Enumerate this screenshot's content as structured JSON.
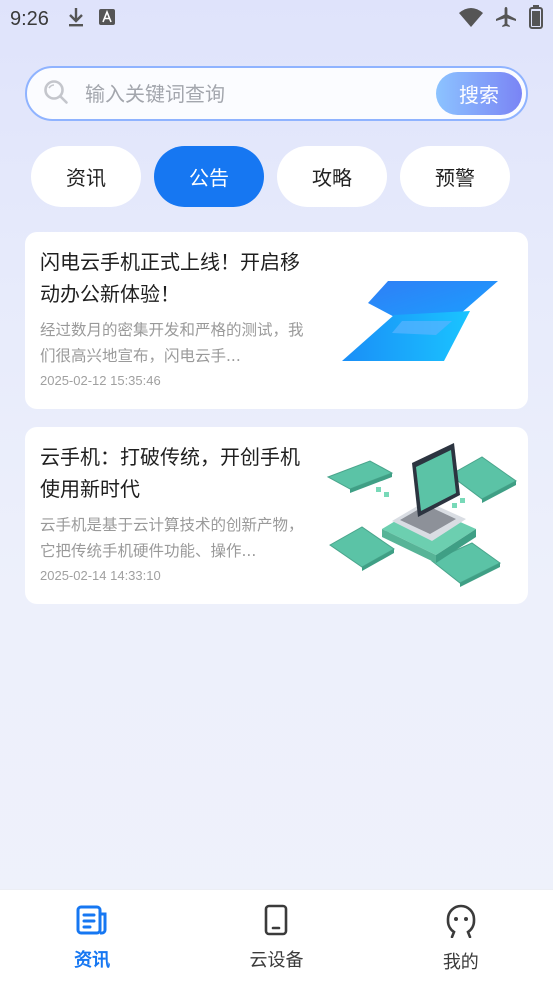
{
  "status_bar": {
    "time": "9:26",
    "left_icons": [
      "download-icon",
      "text-a-icon"
    ],
    "right_icons": [
      "wifi-icon",
      "airplane-icon",
      "battery-icon"
    ]
  },
  "search": {
    "placeholder": "输入关键词查询",
    "button_label": "搜索"
  },
  "tabs": [
    {
      "label": "资讯",
      "active": false
    },
    {
      "label": "公告",
      "active": true
    },
    {
      "label": "攻略",
      "active": false
    },
    {
      "label": "预警",
      "active": false
    }
  ],
  "articles": [
    {
      "title": "闪电云手机正式上线！开启移动办公新体验！",
      "summary": "经过数月的密集开发和严格的测试，我们很高兴地宣布，闪电云手...",
      "date": "2025-02-12 15:35:46",
      "thumb": "lightning-logo-image"
    },
    {
      "title": "云手机：打破传统，开创手机使用新时代",
      "summary": "云手机是基于云计算技术的创新产物，它把传统手机硬件功能、操作...",
      "date": "2025-02-14 14:33:10",
      "thumb": "cloud-phone-illustration"
    }
  ],
  "bottom_nav": [
    {
      "label": "资讯",
      "icon": "news-icon",
      "active": true
    },
    {
      "label": "云设备",
      "icon": "phone-icon",
      "active": false
    },
    {
      "label": "我的",
      "icon": "profile-icon",
      "active": false
    }
  ],
  "colors": {
    "accent": "#1677f2",
    "search_border": "#8fb3ff"
  }
}
